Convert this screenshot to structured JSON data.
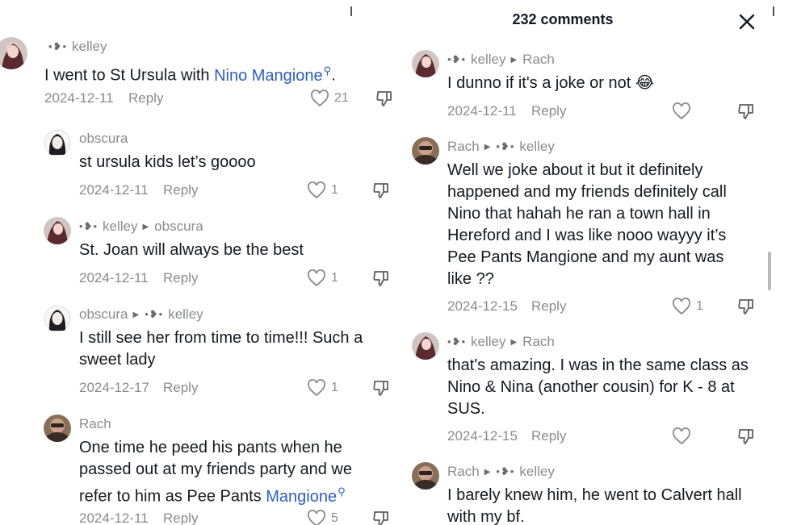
{
  "header": {
    "title": "232 comments",
    "close_icon": "close-icon"
  },
  "left_comments": [
    {
      "author": "kelley",
      "reply_to": "",
      "text": "I went to St Ursula with ",
      "link": "Nino Mangione",
      "text_after": ".",
      "date": "2024-12-11",
      "reply": "Reply",
      "likes": "21"
    },
    {
      "author": "obscura",
      "reply_to": "",
      "text": "st ursula kids let’s goooo",
      "date": "2024-12-11",
      "reply": "Reply",
      "likes": "1"
    },
    {
      "author": "kelley",
      "reply_to": "obscura",
      "text": "St. Joan will always be the best",
      "date": "2024-12-11",
      "reply": "Reply",
      "likes": "1"
    },
    {
      "author": "obscura",
      "reply_to": "kelley",
      "text_lines": [
        "I still see her from time to time!!! Such a",
        "sweet lady"
      ],
      "date": "2024-12-17",
      "reply": "Reply",
      "likes": "1"
    },
    {
      "author": "Rach",
      "reply_to": "",
      "text_lines": [
        "One time he peed his pants when he",
        "passed out at my friends party and we",
        "refer to him as Pee Pants "
      ],
      "link": "Mangione",
      "date": "2024-12-11",
      "reply": "Reply",
      "likes": "5"
    }
  ],
  "right_comments": [
    {
      "author": "kelley",
      "reply_to": "Rach",
      "text": "I dunno if it's a joke or not ",
      "emoji": "😂",
      "date": "2024-12-11",
      "reply": "Reply",
      "likes": ""
    },
    {
      "author": "Rach",
      "reply_to": "kelley",
      "text_lines": [
        "Well we joke about it but it definitely",
        "happened and my friends definitely call",
        "Nino that hahah he ran a town hall in",
        "Hereford and I was like nooo wayyy it’s",
        "Pee Pants Mangione and my aunt was",
        "like ??"
      ],
      "date": "2024-12-15",
      "reply": "Reply",
      "likes": "1"
    },
    {
      "author": "kelley",
      "reply_to": "Rach",
      "text_lines": [
        "that's amazing. I was in the same class as",
        "Nino & Nina (another cousin) for K - 8 at",
        "SUS."
      ],
      "date": "2024-12-15",
      "reply": "Reply",
      "likes": ""
    },
    {
      "author": "Rach",
      "reply_to": "kelley",
      "text_lines": [
        "I barely knew him, he went to Calvert hall",
        "with my bf."
      ]
    }
  ],
  "icons": {
    "like": "heart-icon",
    "dislike": "thumbs-down-icon",
    "search": "search-icon",
    "play": "play-triangle-icon"
  },
  "colors": {
    "link": "#2d5cc7",
    "meta": "#8a8b91",
    "text": "#161823"
  }
}
